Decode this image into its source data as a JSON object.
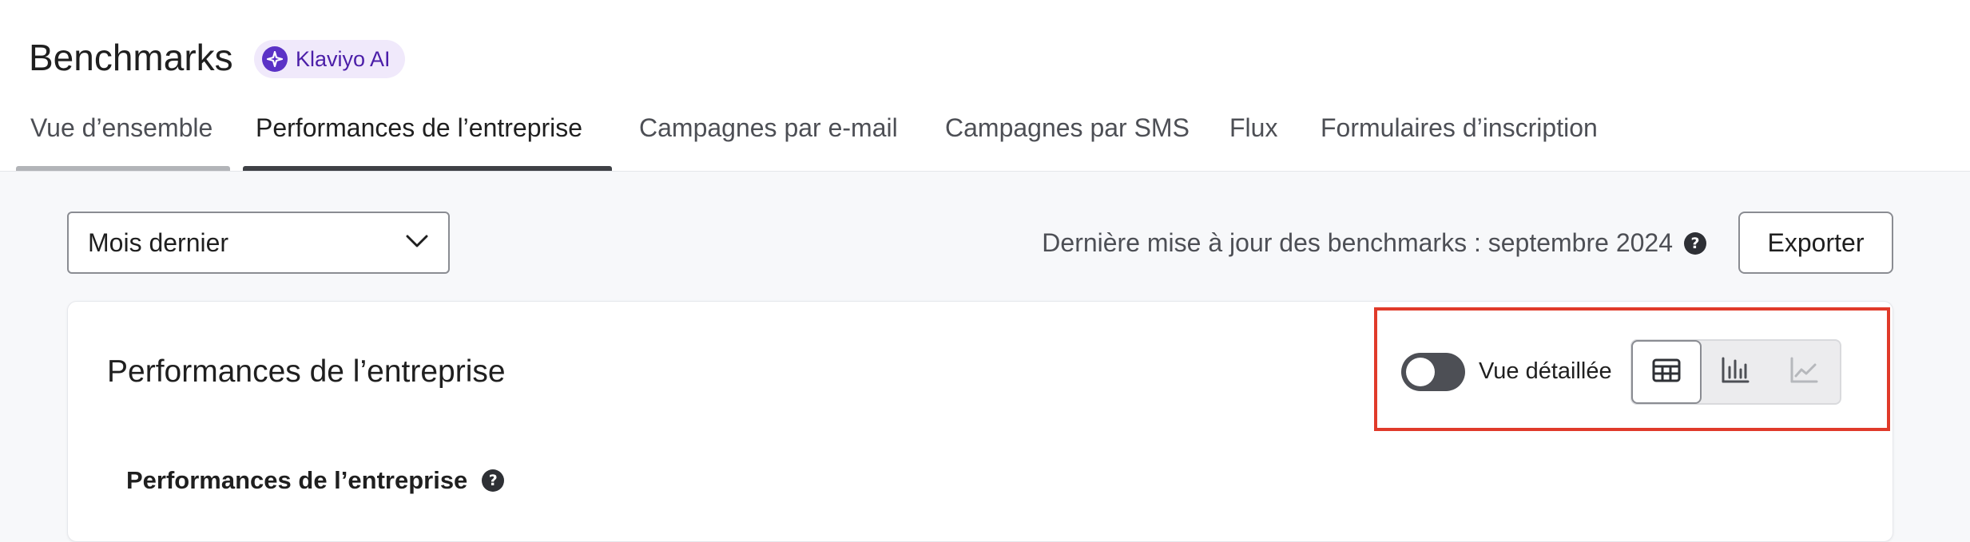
{
  "header": {
    "title": "Benchmarks",
    "ai_badge": "Klaviyo AI"
  },
  "tabs": [
    {
      "label": "Vue d’ensemble",
      "state": "visited"
    },
    {
      "label": "Performances de l’entreprise",
      "state": "active"
    },
    {
      "label": "Campagnes par e-mail",
      "state": "default"
    },
    {
      "label": "Campagnes par SMS",
      "state": "default"
    },
    {
      "label": "Flux",
      "state": "default"
    },
    {
      "label": "Formulaires d’inscription",
      "state": "default"
    }
  ],
  "toolbar": {
    "period_value": "Mois dernier",
    "last_update": "Dernière mise à jour des benchmarks : septembre 2024",
    "help_symbol": "?",
    "export_label": "Exporter"
  },
  "card": {
    "title": "Performances de l’entreprise",
    "detailed_view_label": "Vue détaillée",
    "detailed_view_enabled": false,
    "view_modes": [
      {
        "name": "table",
        "icon": "table-icon",
        "active": true
      },
      {
        "name": "bar",
        "icon": "bar-chart-icon",
        "active": false
      },
      {
        "name": "line",
        "icon": "line-chart-icon",
        "active": false,
        "disabled": true
      }
    ],
    "section_heading": "Performances de l’entreprise"
  },
  "colors": {
    "accent_purple": "#5b32c6",
    "badge_bg": "#f0e9fb",
    "highlight_red": "#e03a2a",
    "toggle_off": "#4d4f55"
  }
}
